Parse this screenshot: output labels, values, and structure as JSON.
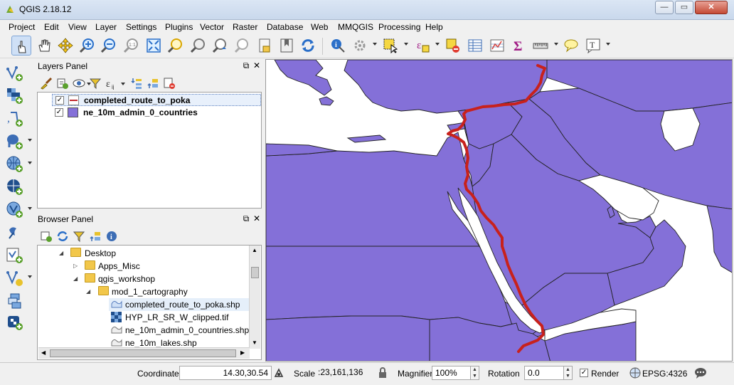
{
  "window": {
    "title": "QGIS 2.18.12"
  },
  "menu": [
    "Project",
    "Edit",
    "View",
    "Layer",
    "Settings",
    "Plugins",
    "Vector",
    "Raster",
    "Database",
    "Web",
    "MMQGIS",
    "Processing",
    "Help"
  ],
  "layers_panel": {
    "title": "Layers Panel",
    "layers": [
      {
        "name": "completed_route_to_poka",
        "checked": true,
        "swatch": "#c0272d"
      },
      {
        "name": "ne_10m_admin_0_countries",
        "checked": true,
        "swatch": "#8470d8"
      }
    ]
  },
  "browser_panel": {
    "title": "Browser Panel",
    "tree": [
      {
        "label": "Desktop",
        "type": "folder"
      },
      {
        "label": "Apps_Misc",
        "type": "folder"
      },
      {
        "label": "qgis_workshop",
        "type": "folder"
      },
      {
        "label": "mod_1_cartography",
        "type": "folder"
      },
      {
        "label": "completed_route_to_poka.shp",
        "type": "vector"
      },
      {
        "label": "HYP_LR_SR_W_clipped.tif",
        "type": "raster"
      },
      {
        "label": "ne_10m_admin_0_countries.shp",
        "type": "vector"
      },
      {
        "label": "ne_10m_lakes.shp",
        "type": "vector"
      }
    ]
  },
  "statusbar": {
    "coordinate_label": "Coordinate",
    "coordinate_value": "14.30,30.54",
    "scale_label": "Scale",
    "scale_value": ":23,161,136",
    "magnifier_label": "Magnifier",
    "magnifier_value": "100%",
    "rotation_label": "Rotation",
    "rotation_value": "0.0",
    "render_label": "Render",
    "render_checked": true,
    "crs_label": "EPSG:4326"
  },
  "colors": {
    "land": "#8470d8",
    "route": "#c8211c",
    "water": "#ffffff"
  }
}
